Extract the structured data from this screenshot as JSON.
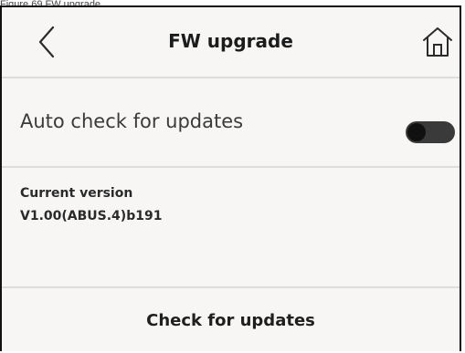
{
  "caption": "Figure 69 FW upgrade",
  "header": {
    "title": "FW upgrade",
    "back_icon": "chevron-left-icon",
    "home_icon": "home-icon"
  },
  "auto_check": {
    "label": "Auto check for updates",
    "toggle_state": "off"
  },
  "version": {
    "label": "Current version",
    "value": "V1.00(ABUS.4)b191"
  },
  "actions": {
    "check_label": "Check for updates"
  },
  "colors": {
    "background": "#f7f6f5",
    "divider": "#dcdcdc",
    "toggle_track": "#3a3a3a",
    "toggle_knob": "#111111"
  }
}
